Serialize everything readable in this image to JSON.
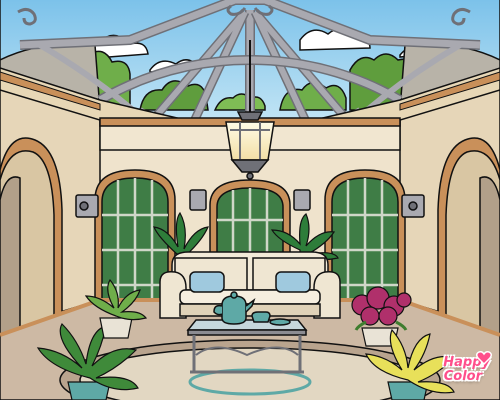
{
  "app": {
    "logo_line1": "Happy",
    "logo_line2": "Color",
    "logo_color": "#ff4f8b"
  },
  "scene": {
    "subject": "sunroom-interior",
    "palette": {
      "sky": "#9fd3ef",
      "cloud": "#ffffff",
      "trees": "#6fae4a",
      "trees_dark": "#3f7d2f",
      "wall": "#efe3cc",
      "wall_shadow": "#d9c6a3",
      "frame_metal": "#a9a9b0",
      "frame_dark": "#6f7077",
      "wood_trim": "#c9905a",
      "window_glass": "#4e8a52",
      "sofa": "#f2ead8",
      "cushion": "#9fc9de",
      "floor": "#cdb9a4",
      "rug": "#d9cdb8",
      "teal": "#5ea9a6",
      "flower_pink": "#b0306b",
      "flower_yellow": "#e8e05a"
    }
  }
}
